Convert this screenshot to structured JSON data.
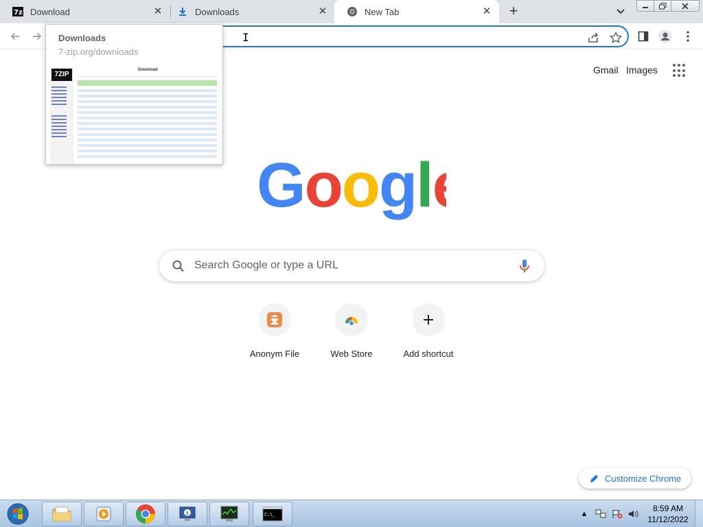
{
  "tabs": [
    {
      "title": "Download",
      "favicon": "7zip-icon"
    },
    {
      "title": "Downloads",
      "favicon": "download-arrow-icon"
    },
    {
      "title": "New Tab",
      "favicon": "chrome-icon",
      "active": true
    }
  ],
  "tab_preview": {
    "title": "Downloads",
    "url": "7-zip.org/downloads",
    "thumb_logo": "7ZIP",
    "thumb_heading": "Download"
  },
  "omnibox": {
    "value": ""
  },
  "header_links": {
    "gmail": "Gmail",
    "images": "Images"
  },
  "search": {
    "placeholder": "Search Google or type a URL"
  },
  "shortcuts": [
    {
      "label": "Anonym File",
      "icon": "anonym-file-icon"
    },
    {
      "label": "Web Store",
      "icon": "web-store-icon"
    },
    {
      "label": "Add shortcut",
      "icon": "plus-icon"
    }
  ],
  "customize": {
    "label": "Customize Chrome"
  },
  "taskbar": {
    "clock_time": "8:59 AM",
    "clock_date": "11/12/2022"
  },
  "colors": {
    "google_blue": "#4285f4",
    "google_red": "#ea4335",
    "google_yellow": "#fbbc05",
    "google_green": "#34a853",
    "accent": "#1a73e8"
  }
}
